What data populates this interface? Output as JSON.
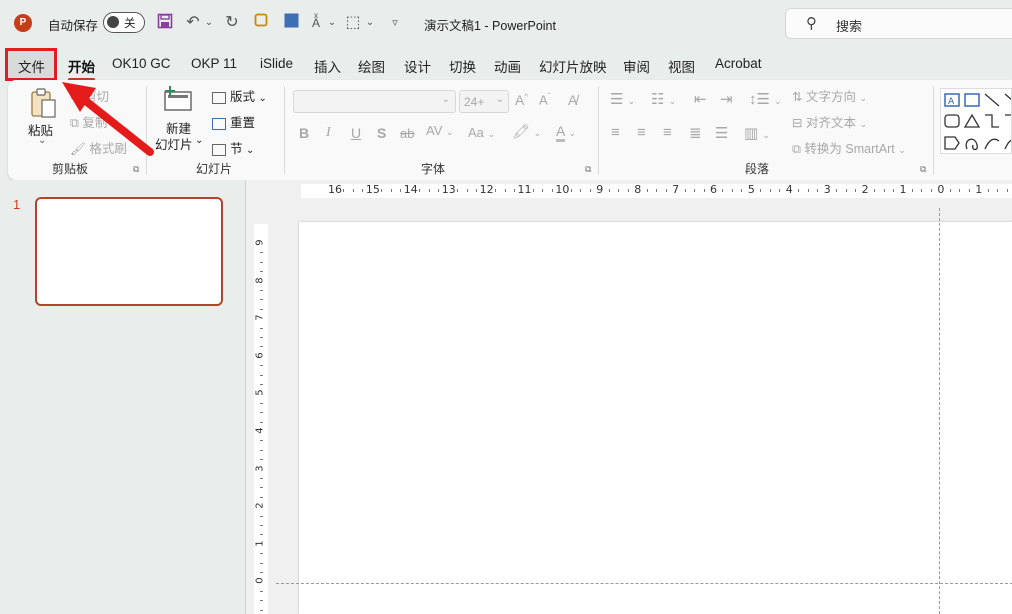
{
  "titlebar": {
    "autosave_label": "自动保存",
    "autosave_state": "关",
    "doc_title": "演示文稿1  -  PowerPoint",
    "search_placeholder": "搜索",
    "app_logo": "P"
  },
  "tabs": [
    "文件",
    "开始",
    "OK10 GC",
    "OKP 11",
    "iSlide",
    "插入",
    "绘图",
    "设计",
    "切换",
    "动画",
    "幻灯片放映",
    "审阅",
    "视图",
    "Acrobat"
  ],
  "active_tab": "开始",
  "ribbon": {
    "clipboard": {
      "paste": "粘贴",
      "cut": "剪切",
      "copy": "复制",
      "format_painter": "格式刷",
      "label": "剪贴板"
    },
    "slides": {
      "new_slide_line1": "新建",
      "new_slide_line2": "幻灯片",
      "layout": "版式",
      "reset": "重置",
      "section": "节",
      "label": "幻灯片"
    },
    "font": {
      "font_size": "24+",
      "label": "字体"
    },
    "paragraph": {
      "text_direction": "文字方向",
      "align_text": "对齐文本",
      "convert_smartart": "转换为 SmartArt",
      "label": "段落"
    }
  },
  "slide_pane": {
    "slide_number": "1"
  },
  "ruler": {
    "h_numbers": [
      "16",
      "15",
      "14",
      "13",
      "12",
      "11",
      "10",
      "9",
      "8",
      "7",
      "6",
      "5",
      "4",
      "3",
      "2",
      "1",
      "0",
      "1"
    ],
    "v_numbers": [
      "9",
      "8",
      "7",
      "6",
      "5",
      "4",
      "3",
      "2",
      "1",
      "0"
    ]
  },
  "colors": {
    "accent": "#c43e1c",
    "highlight": "#e01e1e"
  }
}
